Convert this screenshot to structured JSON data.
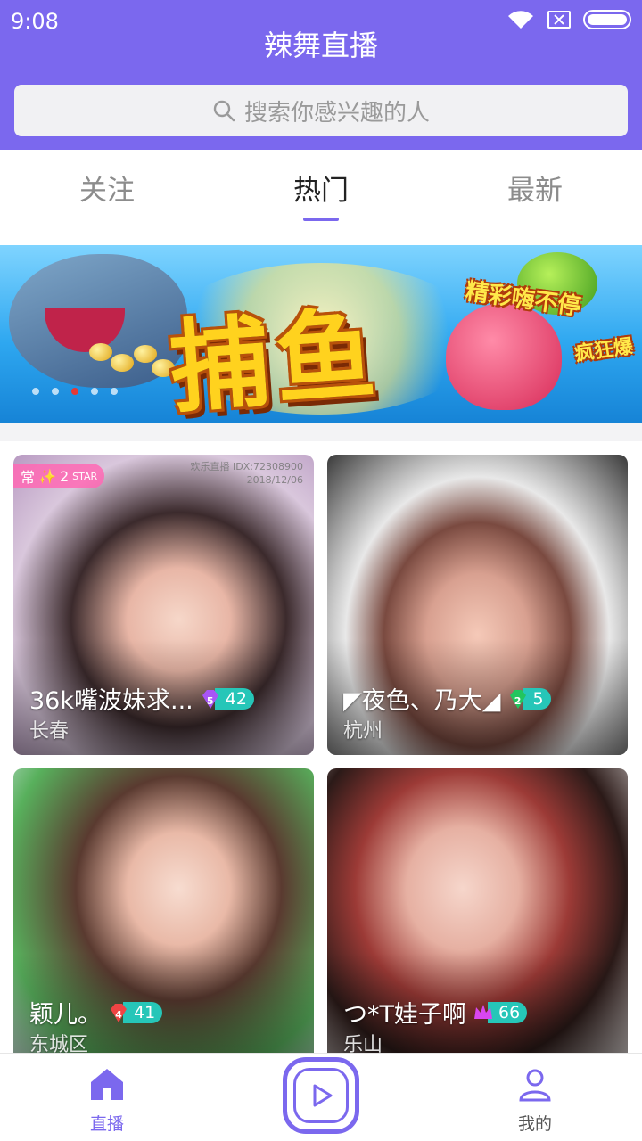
{
  "status_bar": {
    "time": "9:08",
    "icons": [
      "wifi-icon",
      "no-sim-icon",
      "battery-icon"
    ]
  },
  "header": {
    "title": "辣舞直播",
    "search_placeholder": "搜索你感兴趣的人"
  },
  "tabs": [
    {
      "label": "关注",
      "active": false
    },
    {
      "label": "热门",
      "active": true
    },
    {
      "label": "最新",
      "active": false
    }
  ],
  "banner": {
    "title": "捕鱼",
    "slogan_1": "精彩嗨不停",
    "slogan_2": "疯狂爆",
    "dots": 5,
    "active_dot": 2
  },
  "cards": [
    {
      "name": "36k嘴波妹求...",
      "city": "长春",
      "gem_level": "5",
      "gem_color": "#a855f7",
      "level": "42",
      "badge_text": "常",
      "star_text": "2",
      "star_label": "STAR",
      "watermark_line1": "欢乐直播 IDX:72308900",
      "watermark_line2": "2018/12/06"
    },
    {
      "name": "◤夜色、乃大◢",
      "city": "杭州",
      "gem_level": "2",
      "gem_color": "#22c55e",
      "level": "5"
    },
    {
      "name": "颖儿。",
      "city": "东城区",
      "gem_level": "4",
      "gem_color": "#ef4444",
      "level": "41"
    },
    {
      "name": "つ*T娃子啊",
      "city": "乐山",
      "gem_level": "",
      "gem_color": "#d946ef",
      "level": "66"
    }
  ],
  "bottom_nav": {
    "home_label": "直播",
    "mine_label": "我的"
  },
  "colors": {
    "accent": "#7b68ee",
    "level_pill": "#26c6b8"
  }
}
